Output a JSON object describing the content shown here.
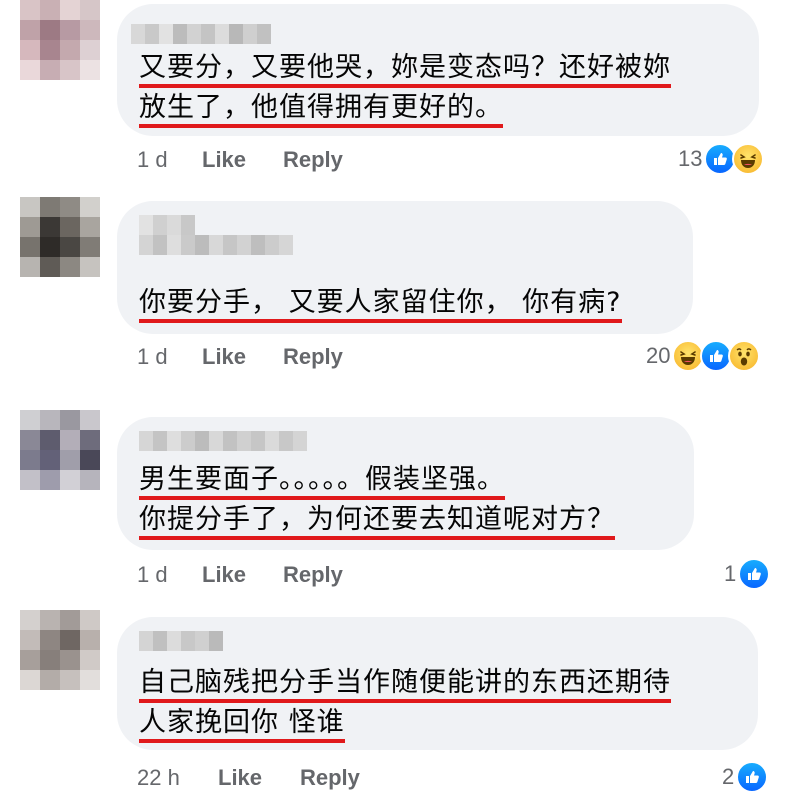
{
  "comments": [
    {
      "lines": [
        "又要分，又要他哭，妳是变态吗？还好被妳",
        "放生了，他值得拥有更好的。"
      ],
      "time": "1 d",
      "like_label": "Like",
      "reply_label": "Reply",
      "reaction_count": "13",
      "reactions": [
        "like-icon",
        "haha-icon"
      ]
    },
    {
      "lines": [
        "你要分手， 又要人家留住你， 你有病?"
      ],
      "time": "1 d",
      "like_label": "Like",
      "reply_label": "Reply",
      "reaction_count": "20",
      "reactions": [
        "haha-icon",
        "like-icon",
        "wow-icon"
      ]
    },
    {
      "lines": [
        "男生要面子。。。。。假装坚强。",
        "你提分手了，为何还要去知道呢对方？"
      ],
      "time": "1 d",
      "like_label": "Like",
      "reply_label": "Reply",
      "reaction_count": "1",
      "reactions": [
        "like-icon"
      ]
    },
    {
      "lines": [
        "自己脑残把分手当作随便能讲的东西还期待",
        "人家挽回你 怪谁"
      ],
      "time": "22 h",
      "like_label": "Like",
      "reply_label": "Reply",
      "reaction_count": "2",
      "reactions": [
        "like-icon"
      ]
    }
  ],
  "colors": {
    "bubble": "#f0f2f5",
    "underline": "#e0191b",
    "meta": "#65676b",
    "like": "#0866ff",
    "haha": "#f7b125"
  }
}
